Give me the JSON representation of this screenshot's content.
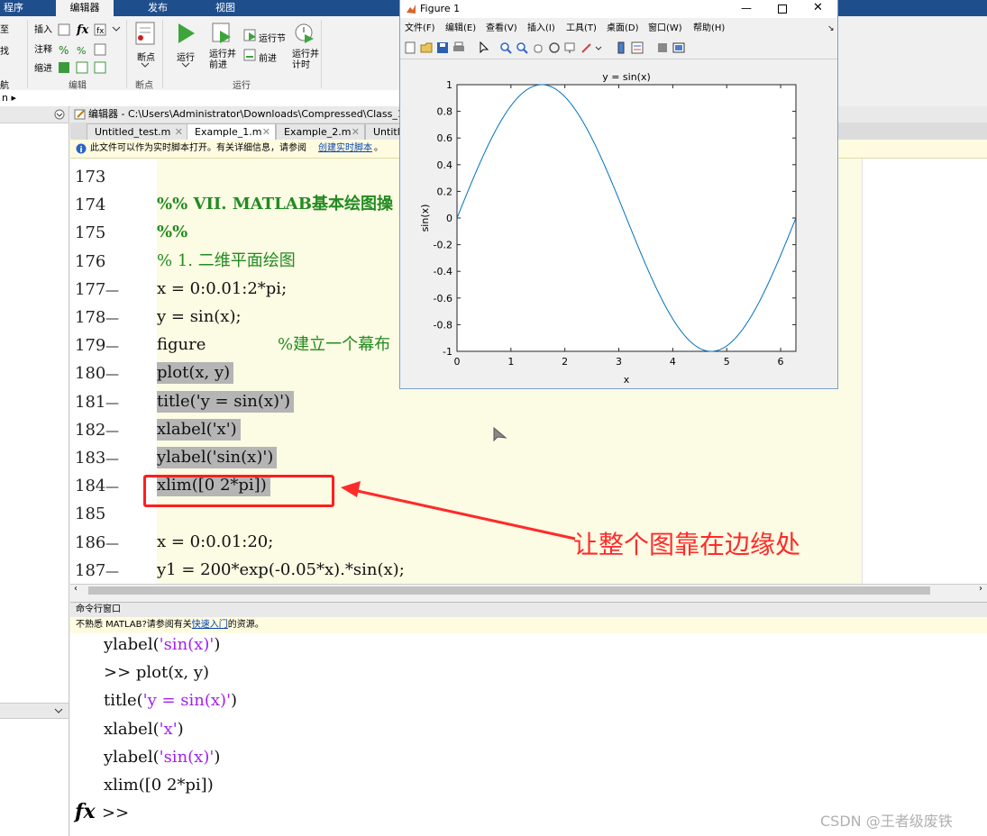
{
  "ribbon": {
    "tabs": [
      "程序",
      "编辑器",
      "发布",
      "视图"
    ],
    "active_tab": "编辑器",
    "insert_label": "插入",
    "comment_label": "注释",
    "indent_label": "缩进",
    "edit_section": "编辑",
    "breakpoint_label": "断点",
    "breakpoint_section": "断点",
    "run_label": "运行",
    "run_advance_label": "运行并\n前进",
    "run_section_label": "运行节",
    "advance_label": "前进",
    "run_time_label": "运行并\n计时",
    "run_section": "运行",
    "left_cut_labels": [
      "至",
      "找",
      "航"
    ]
  },
  "path_text": "n ▸",
  "editor": {
    "title": "编辑器 - C:\\Users\\Administrator\\Downloads\\Compressed\\Class_1_Co",
    "tabs": [
      {
        "label": "Untitled_test.m",
        "active": false
      },
      {
        "label": "Example_1.m",
        "active": true
      },
      {
        "label": "Example_2.m",
        "active": false
      },
      {
        "label": "Untitl",
        "active": false
      }
    ],
    "info_text": "此文件可以作为实时脚本打开。有关详细信息，请参阅",
    "info_link": "创建实时脚本",
    "info_end": "。",
    "lines": [
      {
        "num": "173",
        "dash": "",
        "code": "",
        "kind": "plain"
      },
      {
        "num": "174",
        "dash": "",
        "code": "%% VII. MATLAB基本绘图操",
        "kind": "cell"
      },
      {
        "num": "175",
        "dash": "",
        "code": "%%",
        "kind": "cell"
      },
      {
        "num": "176",
        "dash": "",
        "code": "% 1. 二维平面绘图",
        "kind": "cmt"
      },
      {
        "num": "177",
        "dash": "—",
        "code": "x = 0:0.01:2*pi;",
        "kind": "plain"
      },
      {
        "num": "178",
        "dash": "—",
        "code": "y = sin(x);",
        "kind": "plain"
      },
      {
        "num": "179",
        "dash": "—",
        "code": "figure",
        "kind": "plain",
        "comment": "%建立一个幕布"
      },
      {
        "num": "180",
        "dash": "—",
        "code": "plot(x, y)",
        "kind": "sel"
      },
      {
        "num": "181",
        "dash": "—",
        "code": "title('y = sin(x)')",
        "kind": "sel"
      },
      {
        "num": "182",
        "dash": "—",
        "code": "xlabel('x')",
        "kind": "sel"
      },
      {
        "num": "183",
        "dash": "—",
        "code": "ylabel('sin(x)')",
        "kind": "sel"
      },
      {
        "num": "184",
        "dash": "—",
        "code": "xlim([0 2*pi])",
        "kind": "sel"
      },
      {
        "num": "185",
        "dash": "",
        "code": "",
        "kind": "plain"
      },
      {
        "num": "186",
        "dash": "—",
        "code": "x = 0:0.01:20;",
        "kind": "plain"
      },
      {
        "num": "187",
        "dash": "—",
        "code": "y1 = 200*exp(-0.05*x).*sin(x);",
        "kind": "plain"
      }
    ]
  },
  "command_window": {
    "title": "命令行窗口",
    "info_text": "不熟悉 MATLAB?请参阅有关",
    "info_link": "快速入门",
    "info_end": "的资源。",
    "lines": [
      {
        "pre": "ylabel(",
        "str": "'sin(x)'",
        "post": ")"
      },
      {
        "pre": ">> plot(x, y)",
        "str": "",
        "post": ""
      },
      {
        "pre": "title(",
        "str": "'y = sin(x)'",
        "post": ")"
      },
      {
        "pre": "xlabel(",
        "str": "'x'",
        "post": ")"
      },
      {
        "pre": "ylabel(",
        "str": "'sin(x)'",
        "post": ")"
      },
      {
        "pre": "xlim([0 2*pi])",
        "str": "",
        "post": ""
      }
    ],
    "prompt": ">>",
    "fx": "fx"
  },
  "annotation": {
    "text": "让整个图靠在边缘处",
    "color": "#ff2a2a"
  },
  "watermark": "CSDN @王者级废铁",
  "figure_window": {
    "title": "Figure 1",
    "menu": [
      "文件(F)",
      "编辑(E)",
      "查看(V)",
      "插入(I)",
      "工具(T)",
      "桌面(D)",
      "窗口(W)",
      "帮助(H)"
    ]
  },
  "chart_data": {
    "type": "line",
    "title": "y = sin(x)",
    "xlabel": "x",
    "ylabel": "sin(x)",
    "xlim": [
      0,
      6.2832
    ],
    "ylim": [
      -1,
      1
    ],
    "xticks": [
      0,
      1,
      2,
      3,
      4,
      5,
      6
    ],
    "yticks": [
      1,
      0.8,
      0.6,
      0.4,
      0.2,
      0,
      -0.2,
      -0.4,
      -0.6,
      -0.8,
      -1
    ],
    "ytick_labels": [
      "1",
      "0.8",
      "0.6",
      "0.4",
      "0.2",
      "0",
      "-0.2",
      "-0.4",
      "-0.6",
      "-0.8",
      "-1"
    ],
    "grid": false,
    "series": [
      {
        "function": "sin(x)",
        "x_start": 0,
        "x_end": 6.2832,
        "x_step": 0.01,
        "color": "#0072bd",
        "x": [
          0,
          0.5236,
          1.0472,
          1.5708,
          2.0944,
          2.618,
          3.1416,
          3.6652,
          4.1888,
          4.7124,
          5.236,
          5.7596,
          6.2832
        ],
        "y": [
          0,
          0.5,
          0.866,
          1,
          0.866,
          0.5,
          0,
          -0.5,
          -0.866,
          -1,
          -0.866,
          -0.5,
          0
        ]
      }
    ]
  },
  "colors": {
    "ribbon_tabbar": "#1e4e8c",
    "selection": "#b5b5b5",
    "code_comment": "#228b22",
    "string": "#a020f0",
    "highlight_box": "#ff1e1e"
  }
}
